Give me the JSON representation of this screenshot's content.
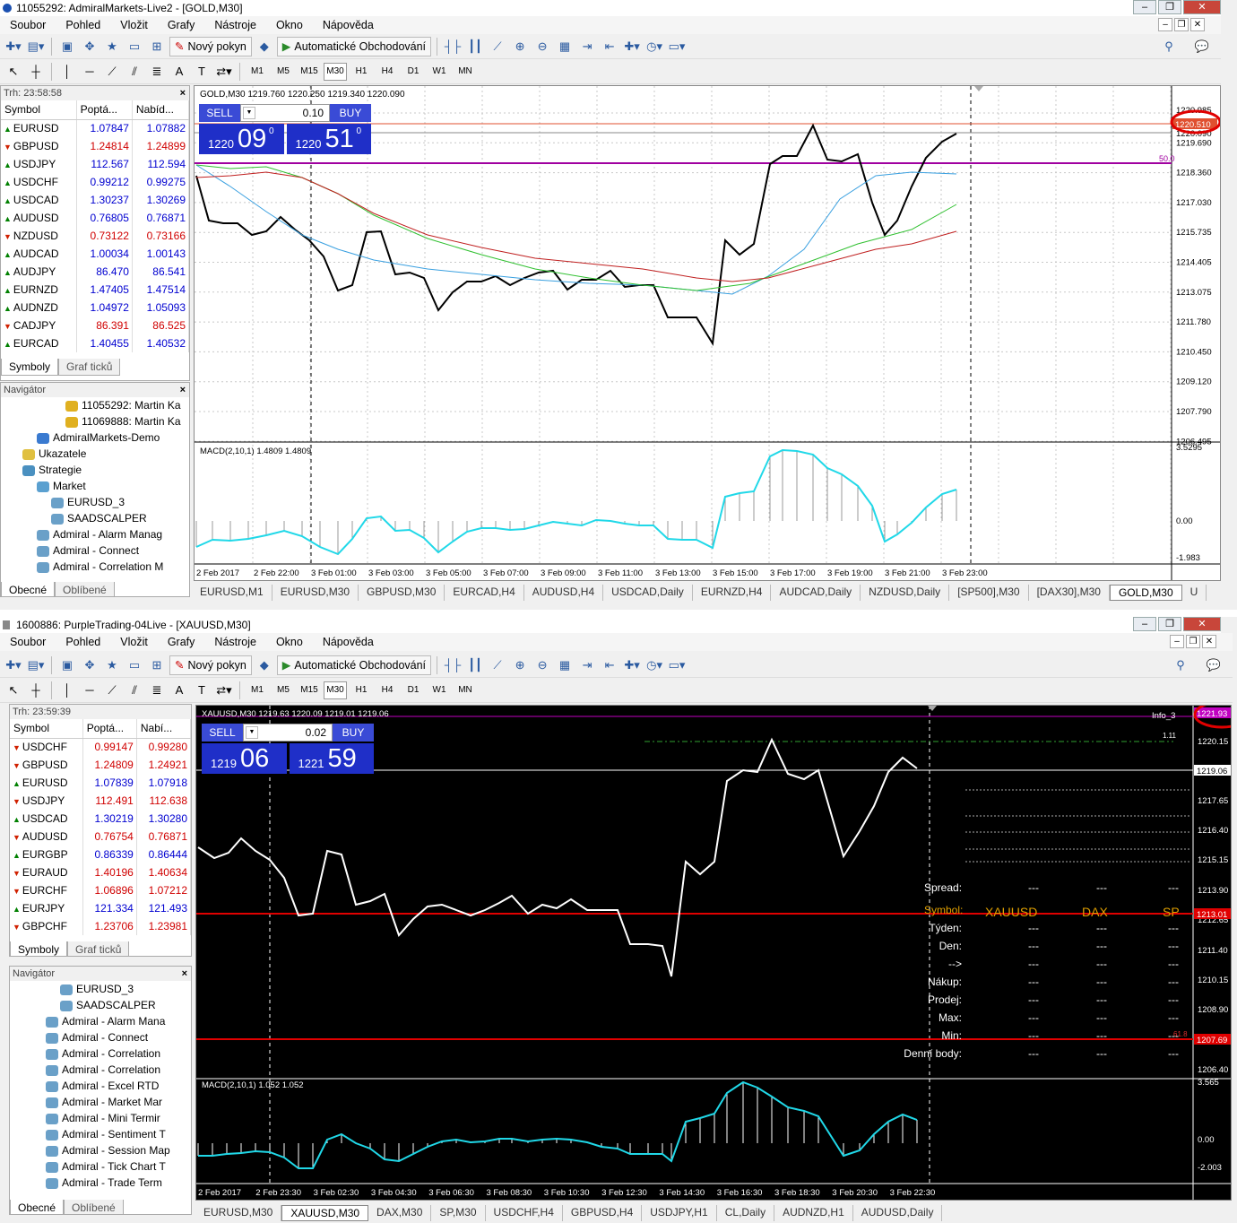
{
  "w1": {
    "title": "11055292: AdmiralMarkets-Live2 - [GOLD,M30]",
    "menu": [
      "Soubor",
      "Pohled",
      "Vložit",
      "Grafy",
      "Nástroje",
      "Okno",
      "Nápověda"
    ],
    "toolbar": {
      "new_order": "Nový pokyn",
      "auto_trading": "Automatické Obchodování"
    },
    "timeframes": [
      "M1",
      "M5",
      "M15",
      "M30",
      "H1",
      "H4",
      "D1",
      "W1",
      "MN"
    ],
    "active_tf": "M30",
    "market_watch": {
      "time": "Trh: 23:58:58",
      "headers": [
        "Symbol",
        "Poptá...",
        "Nabíd..."
      ],
      "rows": [
        {
          "dir": "up",
          "symbol": "EURUSD",
          "bid": "1.07847",
          "ask": "1.07882",
          "color": "blue"
        },
        {
          "dir": "dn",
          "symbol": "GBPUSD",
          "bid": "1.24814",
          "ask": "1.24899",
          "color": "red"
        },
        {
          "dir": "up",
          "symbol": "USDJPY",
          "bid": "112.567",
          "ask": "112.594",
          "color": "blue"
        },
        {
          "dir": "up",
          "symbol": "USDCHF",
          "bid": "0.99212",
          "ask": "0.99275",
          "color": "blue"
        },
        {
          "dir": "up",
          "symbol": "USDCAD",
          "bid": "1.30237",
          "ask": "1.30269",
          "color": "blue"
        },
        {
          "dir": "up",
          "symbol": "AUDUSD",
          "bid": "0.76805",
          "ask": "0.76871",
          "color": "blue"
        },
        {
          "dir": "dn",
          "symbol": "NZDUSD",
          "bid": "0.73122",
          "ask": "0.73166",
          "color": "red"
        },
        {
          "dir": "up",
          "symbol": "AUDCAD",
          "bid": "1.00034",
          "ask": "1.00143",
          "color": "blue"
        },
        {
          "dir": "up",
          "symbol": "AUDJPY",
          "bid": "86.470",
          "ask": "86.541",
          "color": "blue"
        },
        {
          "dir": "up",
          "symbol": "EURNZD",
          "bid": "1.47405",
          "ask": "1.47514",
          "color": "blue"
        },
        {
          "dir": "up",
          "symbol": "AUDNZD",
          "bid": "1.04972",
          "ask": "1.05093",
          "color": "blue"
        },
        {
          "dir": "dn",
          "symbol": "CADJPY",
          "bid": "86.391",
          "ask": "86.525",
          "color": "red"
        },
        {
          "dir": "up",
          "symbol": "EURCAD",
          "bid": "1.40455",
          "ask": "1.40532",
          "color": "blue"
        }
      ],
      "tabs": [
        "Symboly",
        "Graf ticků"
      ]
    },
    "navigator": {
      "title": "Navigátor",
      "items": [
        {
          "label": "11055292: Martin Ka",
          "indent": 4,
          "icon": "account-icon"
        },
        {
          "label": "11069888: Martin Ka",
          "indent": 4,
          "icon": "account-icon"
        },
        {
          "label": "AdmiralMarkets-Demo",
          "indent": 2,
          "icon": "server-icon"
        },
        {
          "label": "Ukazatele",
          "indent": 1,
          "icon": "indicators-icon"
        },
        {
          "label": "Strategie",
          "indent": 1,
          "icon": "strategy-icon"
        },
        {
          "label": "Market",
          "indent": 2,
          "icon": "folder-icon"
        },
        {
          "label": "EURUSD_3",
          "indent": 3,
          "icon": "expert-icon"
        },
        {
          "label": "SAADSCALPER",
          "indent": 3,
          "icon": "expert-icon"
        },
        {
          "label": "Admiral - Alarm Manag",
          "indent": 2,
          "icon": "expert-icon"
        },
        {
          "label": "Admiral - Connect",
          "indent": 2,
          "icon": "expert-icon"
        },
        {
          "label": "Admiral - Correlation M",
          "indent": 2,
          "icon": "expert-icon"
        }
      ],
      "tabs": [
        "Obecné",
        "Oblíbené"
      ]
    },
    "chart": {
      "header": "GOLD,M30  1219.760 1220.250 1219.340 1220.090",
      "sell_label": "SELL",
      "buy_label": "BUY",
      "lot": "0.10",
      "sell_small": "1220",
      "sell_big": "09",
      "sell_sup": "0",
      "buy_small": "1220",
      "buy_big": "51",
      "buy_sup": "0",
      "price_labels": [
        "1220.985",
        "1219.690",
        "1218.360",
        "1217.030",
        "1215.735",
        "1214.405",
        "1213.075",
        "1211.780",
        "1210.450",
        "1209.120",
        "1207.790",
        "1206.495"
      ],
      "current_price": "1220.510",
      "partial_price": "1220.090",
      "level_label": "50.0",
      "macd_header": "MACD(2,10,1) 1.4809 1.4809",
      "macd_labels": [
        "3.5295",
        "0.00",
        "-1.983"
      ],
      "time_labels": [
        "2 Feb 2017",
        "2 Feb 22:00",
        "3 Feb 01:00",
        "3 Feb 03:00",
        "3 Feb 05:00",
        "3 Feb 07:00",
        "3 Feb 09:00",
        "3 Feb 11:00",
        "3 Feb 13:00",
        "3 Feb 15:00",
        "3 Feb 17:00",
        "3 Feb 19:00",
        "3 Feb 21:00",
        "3 Feb 23:00"
      ]
    },
    "chart_tabs": [
      "EURUSD,M1",
      "EURUSD,M30",
      "GBPUSD,M30",
      "EURCAD,H4",
      "AUDUSD,H4",
      "USDCAD,Daily",
      "EURNZD,H4",
      "AUDCAD,Daily",
      "NZDUSD,Daily",
      "[SP500],M30",
      "[DAX30],M30",
      "GOLD,M30",
      "U"
    ],
    "active_chart_tab": "GOLD,M30"
  },
  "w2": {
    "title": "1600886: PurpleTrading-04Live - [XAUUSD,M30]",
    "menu": [
      "Soubor",
      "Pohled",
      "Vložit",
      "Grafy",
      "Nástroje",
      "Okno",
      "Nápověda"
    ],
    "toolbar": {
      "new_order": "Nový pokyn",
      "auto_trading": "Automatické Obchodování"
    },
    "timeframes": [
      "M1",
      "M5",
      "M15",
      "M30",
      "H1",
      "H4",
      "D1",
      "W1",
      "MN"
    ],
    "active_tf": "M30",
    "market_watch": {
      "time": "Trh: 23:59:39",
      "headers": [
        "Symbol",
        "Poptá...",
        "Nabí..."
      ],
      "rows": [
        {
          "dir": "dn",
          "symbol": "USDCHF",
          "bid": "0.99147",
          "ask": "0.99280",
          "color": "red"
        },
        {
          "dir": "dn",
          "symbol": "GBPUSD",
          "bid": "1.24809",
          "ask": "1.24921",
          "color": "red"
        },
        {
          "dir": "up",
          "symbol": "EURUSD",
          "bid": "1.07839",
          "ask": "1.07918",
          "color": "blue"
        },
        {
          "dir": "dn",
          "symbol": "USDJPY",
          "bid": "112.491",
          "ask": "112.638",
          "color": "red"
        },
        {
          "dir": "up",
          "symbol": "USDCAD",
          "bid": "1.30219",
          "ask": "1.30280",
          "color": "blue"
        },
        {
          "dir": "dn",
          "symbol": "AUDUSD",
          "bid": "0.76754",
          "ask": "0.76871",
          "color": "red"
        },
        {
          "dir": "up",
          "symbol": "EURGBP",
          "bid": "0.86339",
          "ask": "0.86444",
          "color": "blue"
        },
        {
          "dir": "dn",
          "symbol": "EURAUD",
          "bid": "1.40196",
          "ask": "1.40634",
          "color": "red"
        },
        {
          "dir": "dn",
          "symbol": "EURCHF",
          "bid": "1.06896",
          "ask": "1.07212",
          "color": "red"
        },
        {
          "dir": "up",
          "symbol": "EURJPY",
          "bid": "121.334",
          "ask": "121.493",
          "color": "blue"
        },
        {
          "dir": "dn",
          "symbol": "GBPCHF",
          "bid": "1.23706",
          "ask": "1.23981",
          "color": "red"
        }
      ],
      "tabs": [
        "Symboly",
        "Graf ticků"
      ]
    },
    "navigator": {
      "title": "Navigátor",
      "items": [
        {
          "label": "EURUSD_3",
          "indent": 3,
          "icon": "expert-icon"
        },
        {
          "label": "SAADSCALPER",
          "indent": 3,
          "icon": "expert-icon"
        },
        {
          "label": "Admiral - Alarm Mana",
          "indent": 2,
          "icon": "expert-icon"
        },
        {
          "label": "Admiral - Connect",
          "indent": 2,
          "icon": "expert-icon"
        },
        {
          "label": "Admiral - Correlation",
          "indent": 2,
          "icon": "expert-icon"
        },
        {
          "label": "Admiral - Correlation",
          "indent": 2,
          "icon": "expert-icon"
        },
        {
          "label": "Admiral - Excel RTD",
          "indent": 2,
          "icon": "expert-icon"
        },
        {
          "label": "Admiral - Market Mar",
          "indent": 2,
          "icon": "expert-icon"
        },
        {
          "label": "Admiral - Mini Termir",
          "indent": 2,
          "icon": "expert-icon"
        },
        {
          "label": "Admiral - Sentiment T",
          "indent": 2,
          "icon": "expert-icon"
        },
        {
          "label": "Admiral - Session Map",
          "indent": 2,
          "icon": "expert-icon"
        },
        {
          "label": "Admiral - Tick Chart T",
          "indent": 2,
          "icon": "expert-icon"
        },
        {
          "label": "Admiral - Trade Term",
          "indent": 2,
          "icon": "expert-icon"
        }
      ],
      "tabs": [
        "Obecné",
        "Oblíbené"
      ]
    },
    "chart": {
      "header": "XAUUSD,M30  1219.63 1220.09 1219.01 1219.06",
      "info_label": "Info_3",
      "sell_label": "SELL",
      "buy_label": "BUY",
      "lot": "0.02",
      "sell_small": "1219",
      "sell_big": "06",
      "buy_small": "1221",
      "buy_big": "59",
      "price_labels": [
        "1220.15",
        "1217.65",
        "1216.40",
        "1215.15",
        "1213.90",
        "1212.65",
        "1211.40",
        "1210.15",
        "1208.90",
        "1206.40"
      ],
      "current_price": "1219.06",
      "red_line_label": "1213.01",
      "red_line2_label": "1207.69",
      "top_price": "1221.93",
      "level_label": "61.8",
      "level_label2": "1.11",
      "info_panel": {
        "spread_label": "Spread:",
        "symbol_label": "Symbol:",
        "symbols": [
          "XAUUSD",
          "DAX",
          "SP"
        ],
        "rows": [
          "Týden:",
          "Den:",
          "-->",
          "Nákup:",
          "Prodej:",
          "Max:",
          "Min:",
          "Denní body:"
        ],
        "dash": "---"
      },
      "macd_header": "MACD(2,10,1) 1.052 1.052",
      "macd_labels": [
        "3.565",
        "0.00",
        "-2.003"
      ],
      "time_labels": [
        "2 Feb 2017",
        "2 Feb 23:30",
        "3 Feb 02:30",
        "3 Feb 04:30",
        "3 Feb 06:30",
        "3 Feb 08:30",
        "3 Feb 10:30",
        "3 Feb 12:30",
        "3 Feb 14:30",
        "3 Feb 16:30",
        "3 Feb 18:30",
        "3 Feb 20:30",
        "3 Feb 22:30"
      ]
    },
    "chart_tabs": [
      "EURUSD,M30",
      "XAUUSD,M30",
      "DAX,M30",
      "SP,M30",
      "USDCHF,H4",
      "GBPUSD,H4",
      "USDJPY,H1",
      "CL,Daily",
      "AUDNZD,H1",
      "AUDUSD,Daily"
    ],
    "active_chart_tab": "XAUUSD,M30"
  },
  "colors": {
    "annotation_circle": "#e00000",
    "sell_bg": "#3a4bd6",
    "price_bg": "#1f2fc8"
  }
}
